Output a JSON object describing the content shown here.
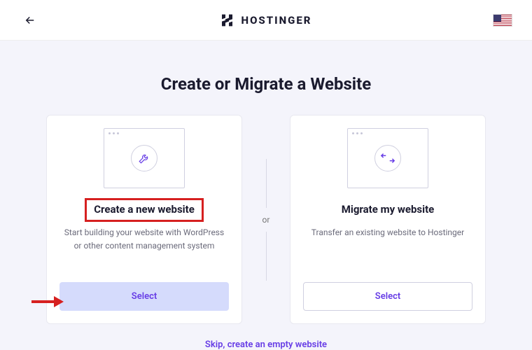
{
  "header": {
    "brand": "HOSTINGER"
  },
  "page": {
    "title": "Create or Migrate a Website",
    "divider_label": "or",
    "skip_label": "Skip, create an empty website"
  },
  "cards": {
    "create": {
      "title": "Create a new website",
      "desc": "Start building your website with WordPress or other content management system",
      "button": "Select"
    },
    "migrate": {
      "title": "Migrate my website",
      "desc": "Transfer an existing website to Hostinger",
      "button": "Select"
    }
  }
}
